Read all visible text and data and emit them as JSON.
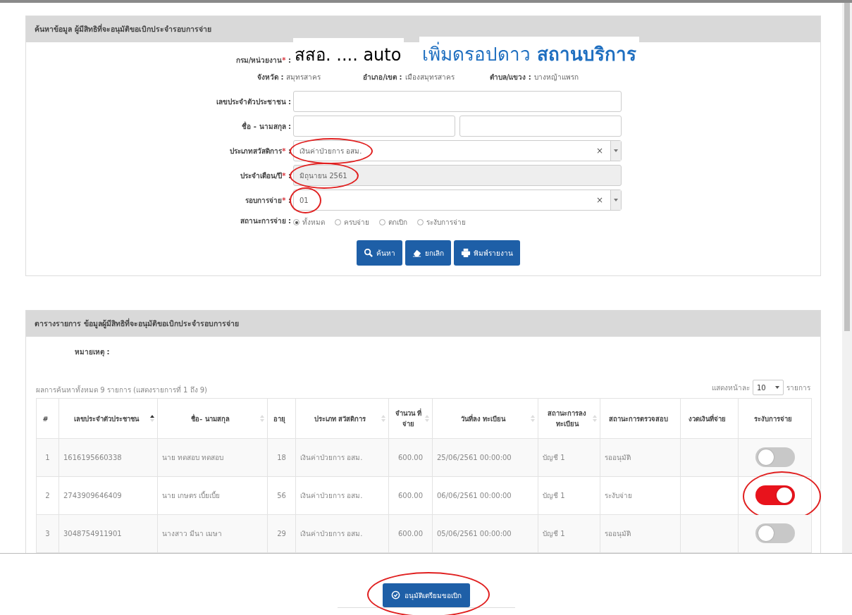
{
  "search_panel": {
    "title": "ค้นหาข้อมูล ผู้มีสิทธิที่จะอนุมัติขอเบิกประจำรอบการจ่าย",
    "fields": [
      {
        "kind": "annotated",
        "label": "กรม/หน่วยงาน",
        "mark": "*",
        "suffix": " :",
        "value": "สสอ. .... auto",
        "note": "เพิ่มดรอปดาว **สถานบริการ**"
      },
      {
        "kind": "location",
        "items": [
          {
            "label": "จังหวัด :",
            "value": "สมุทรสาคร"
          },
          {
            "label": "อำเภอ/เขต :",
            "value": "เมืองสมุทรสาคร"
          },
          {
            "label": "ตำบล/แขวง :",
            "value": "บางหญ้าแพรก"
          }
        ]
      },
      {
        "kind": "text",
        "label": "เลขประจำตัวประชาชน",
        "suffix": " :"
      },
      {
        "kind": "name",
        "label": "ชื่อ - นามสกุล",
        "suffix": " :"
      },
      {
        "kind": "select",
        "label": "ประเภทสวัสดิการ",
        "mark": "*",
        "suffix": " :",
        "value": "เงินค่าป่วยการ อสม.",
        "clear_symbol": "×",
        "circled": true
      },
      {
        "kind": "readonly",
        "label": "ประจำเดือน/ปี",
        "mark": "*",
        "suffix": " :",
        "value": "มิถุนายน 2561",
        "circled": true
      },
      {
        "kind": "select",
        "label": "รอบการจ่าย",
        "mark": "*",
        "suffix": " :",
        "value": "01",
        "clear_symbol": "×",
        "circled": true
      },
      {
        "kind": "radio",
        "label": "สถานะการจ่าย",
        "suffix": " :",
        "options": [
          {
            "label": "ทั้งหมด",
            "selected": true
          },
          {
            "label": "ครบจ่าย",
            "selected": false
          },
          {
            "label": "ตกเบิก",
            "selected": false
          },
          {
            "label": "ระงับการจ่าย",
            "selected": false
          }
        ]
      }
    ],
    "buttons": [
      {
        "label": "ค้นหา"
      },
      {
        "label": "ยกเลิก"
      },
      {
        "label": "พิมพ์รายงาน"
      }
    ]
  },
  "table_panel": {
    "title": "ตารางรายการ ข้อมูลผู้มีสิทธิที่จะอนุมัติขอเบิกประจำรอบการจ่าย",
    "note_label": "หมายเหตุ :",
    "summary": "ผลการค้นหาทั้งหมด 9 รายการ (แสดงรายการที่ 1 ถึง 9)",
    "page_size": {
      "before": "แสดงหน้าละ",
      "value": "10",
      "after": "รายการ"
    },
    "columns": [
      {
        "label": "#",
        "sortable": false
      },
      {
        "label": "เลขประจำตัวประชาชน",
        "sortable": true,
        "sorted": true
      },
      {
        "label": "ชื่อ- นามสกุล",
        "sortable": true,
        "sorted": false
      },
      {
        "label": "อายุ",
        "sortable": false
      },
      {
        "label": "ประเภท สวัสดิการ",
        "sortable": true,
        "sorted": false
      },
      {
        "label": "จำนวน ที่จ่าย",
        "sortable": true,
        "sorted": false
      },
      {
        "label": "วันที่ลง ทะเบียน",
        "sortable": true,
        "sorted": false
      },
      {
        "label": "สถานะการลง ทะเบียน",
        "sortable": true,
        "sorted": false
      },
      {
        "label": "สถานะการตรวจสอบ",
        "sortable": false
      },
      {
        "label": "งวดเงินที่จ่าย",
        "sortable": false
      },
      {
        "label": "ระงับการจ่าย",
        "sortable": false
      }
    ],
    "rows": [
      {
        "cells": [
          "1",
          "1616195660338",
          "นาย ทดสอบ ทดสอบ",
          "18",
          "เงินค่าป่วยการ อสม.",
          "600.00",
          "25/06/2561 00:00:00",
          "บัญชี 1",
          "รออนุมัติ"
        ],
        "suspended": false,
        "circled": false
      },
      {
        "cells": [
          "2",
          "2743909646409",
          "นาย เกษตร เบี้ยเบี้ย",
          "56",
          "เงินค่าป่วยการ อสม.",
          "600.00",
          "06/06/2561 00:00:00",
          "บัญชี 1",
          "ระงับจ่าย"
        ],
        "suspended": true,
        "circled": true
      },
      {
        "cells": [
          "3",
          "3048754911901",
          "นางสาว มีนา เมษา",
          "29",
          "เงินค่าป่วยการ อสม.",
          "600.00",
          "05/06/2561 00:00:00",
          "บัญชี 1",
          "รออนุมัติ"
        ],
        "suspended": false,
        "circled": false
      }
    ]
  },
  "approve_button": {
    "label": "อนุมัติเตรียมขอเบิก",
    "circled": true
  }
}
